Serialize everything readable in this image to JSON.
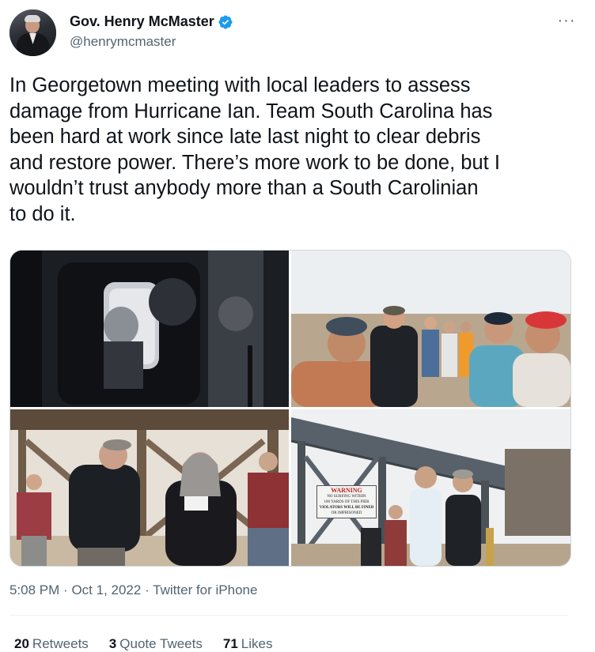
{
  "author": {
    "name": "Gov. Henry McMaster",
    "handle": "@henrymcmaster",
    "verified": true
  },
  "menu_icon": "more-horizontal-icon",
  "tweet": {
    "text": "In Georgetown meeting with local leaders to assess\ndamage from Hurricane Ian. Team South Carolina has\nbeen hard at work since late last night to clear debris\nand restore power. There’s more work to be done, but I\nwouldn’t trust anybody more than a South Carolinian\nto do it."
  },
  "media": {
    "photos": [
      {
        "description_icon": "photo-helicopter-interior"
      },
      {
        "description_icon": "photo-beach-group-meeting"
      },
      {
        "description_icon": "photo-pier-handshake"
      },
      {
        "description_icon": "photo-pier-warning-sign"
      }
    ],
    "sign": {
      "title": "WARNING",
      "line1": "NO SURFING WITHIN",
      "line2": "100 YARDS OF THIS PIER",
      "line3": "VIOLATORS WILL BE FINED",
      "line4": "OR IMPRISONED"
    }
  },
  "meta": {
    "time": "5:08 PM",
    "separator": "·",
    "date": "Oct 1, 2022",
    "client": "Twitter for iPhone"
  },
  "stats": {
    "retweets_count": "20",
    "retweets_label": "Retweets",
    "quotes_count": "3",
    "quotes_label": "Quote Tweets",
    "likes_count": "71",
    "likes_label": "Likes"
  },
  "colors": {
    "text_primary": "#0f1419",
    "text_secondary": "#536471",
    "verified_blue": "#1d9bf0",
    "border": "#cfd9de"
  }
}
